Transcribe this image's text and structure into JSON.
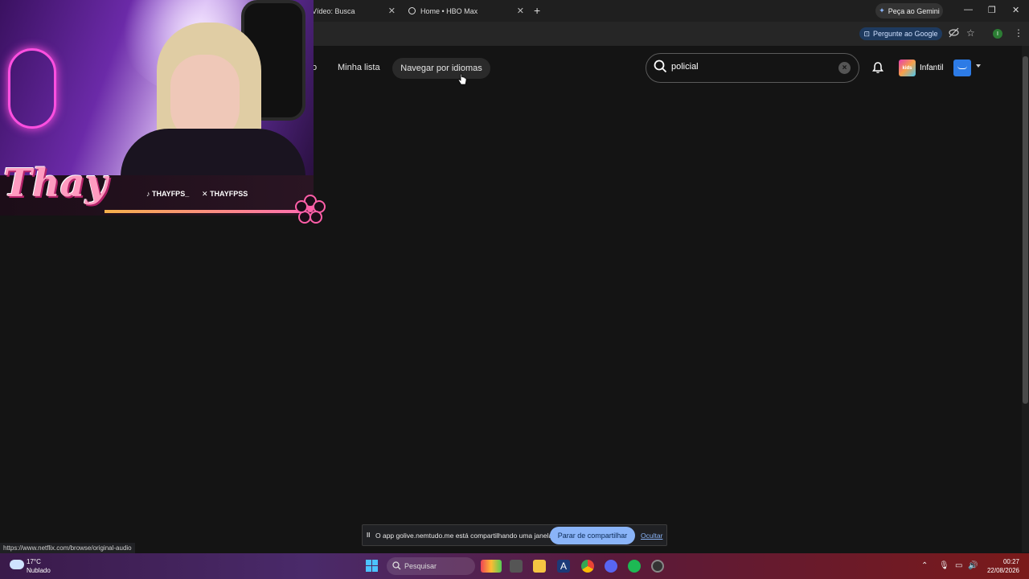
{
  "browser": {
    "tabs": [
      {
        "label": "Vídeo: Busca"
      },
      {
        "label": "Home • HBO Max"
      }
    ],
    "new_tab": "+",
    "gemini_label": "Peça ao Gemini",
    "ask_google_label": "Pergunte ao Google",
    "window_controls": {
      "minimize": "—",
      "restore": "❐",
      "close": "✕"
    },
    "extension_badge": "I"
  },
  "netflix": {
    "nav": {
      "partial": "o",
      "my_list": "Minha lista",
      "browse_languages": "Navegar por idiomas"
    },
    "search": {
      "value": "policial"
    },
    "kids_label": "Infantil",
    "kids_avatar_text": "kids"
  },
  "stream_overlay": {
    "logo": "Thay",
    "tiktok": "THAYFPS_",
    "x": "THAYFPSS"
  },
  "share_bar": {
    "pause": "II",
    "message": "O app golive.nemtudo.me está compartilhando uma janela.",
    "stop_label": "Parar de compartilhar",
    "hide_label": "Ocultar"
  },
  "status_url": "https://www.netflix.com/browse/original-audio",
  "taskbar": {
    "temperature": "17°C",
    "weather": "Nublado",
    "search_placeholder": "Pesquisar",
    "time": "00:27",
    "date": "22/08/2026"
  }
}
